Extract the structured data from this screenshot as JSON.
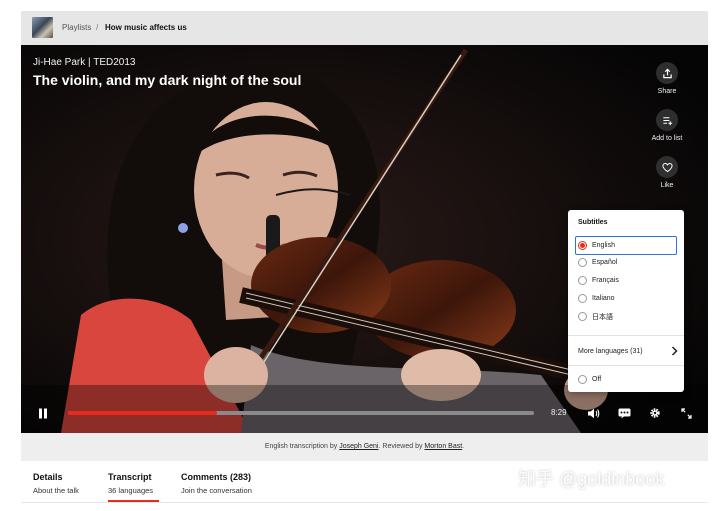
{
  "breadcrumb": {
    "playlists": "Playlists",
    "separator": "/",
    "current": "How music affects us"
  },
  "video": {
    "speaker": "Ji-Hae Park | TED2013",
    "title": "The violin, and my dark night of the soul",
    "actions": {
      "share": "Share",
      "add_to_list": "Add to list",
      "like": "Like"
    },
    "time": "8:29",
    "progress": 0.32
  },
  "subtitles": {
    "heading": "Subtitles",
    "languages": [
      {
        "label": "English",
        "selected": true
      },
      {
        "label": "Español",
        "selected": false
      },
      {
        "label": "Français",
        "selected": false
      },
      {
        "label": "Italiano",
        "selected": false
      },
      {
        "label": "日本語",
        "selected": false
      }
    ],
    "more": "More languages (31)",
    "off": "Off"
  },
  "credit": {
    "prefix": "English transcription by",
    "transcriber": "Joseph Geni",
    "middle": ". Reviewed by",
    "reviewer": "Morton Bast",
    "suffix": "."
  },
  "tabs": [
    {
      "label": "Details",
      "sub": "About the talk"
    },
    {
      "label": "Transcript",
      "sub": "36 languages"
    },
    {
      "label": "Comments (283)",
      "sub": "Join the conversation"
    }
  ],
  "watermark": "知乎 @goldinbook",
  "colors": {
    "accent": "#e62b1e",
    "focus": "#2f72d6"
  }
}
